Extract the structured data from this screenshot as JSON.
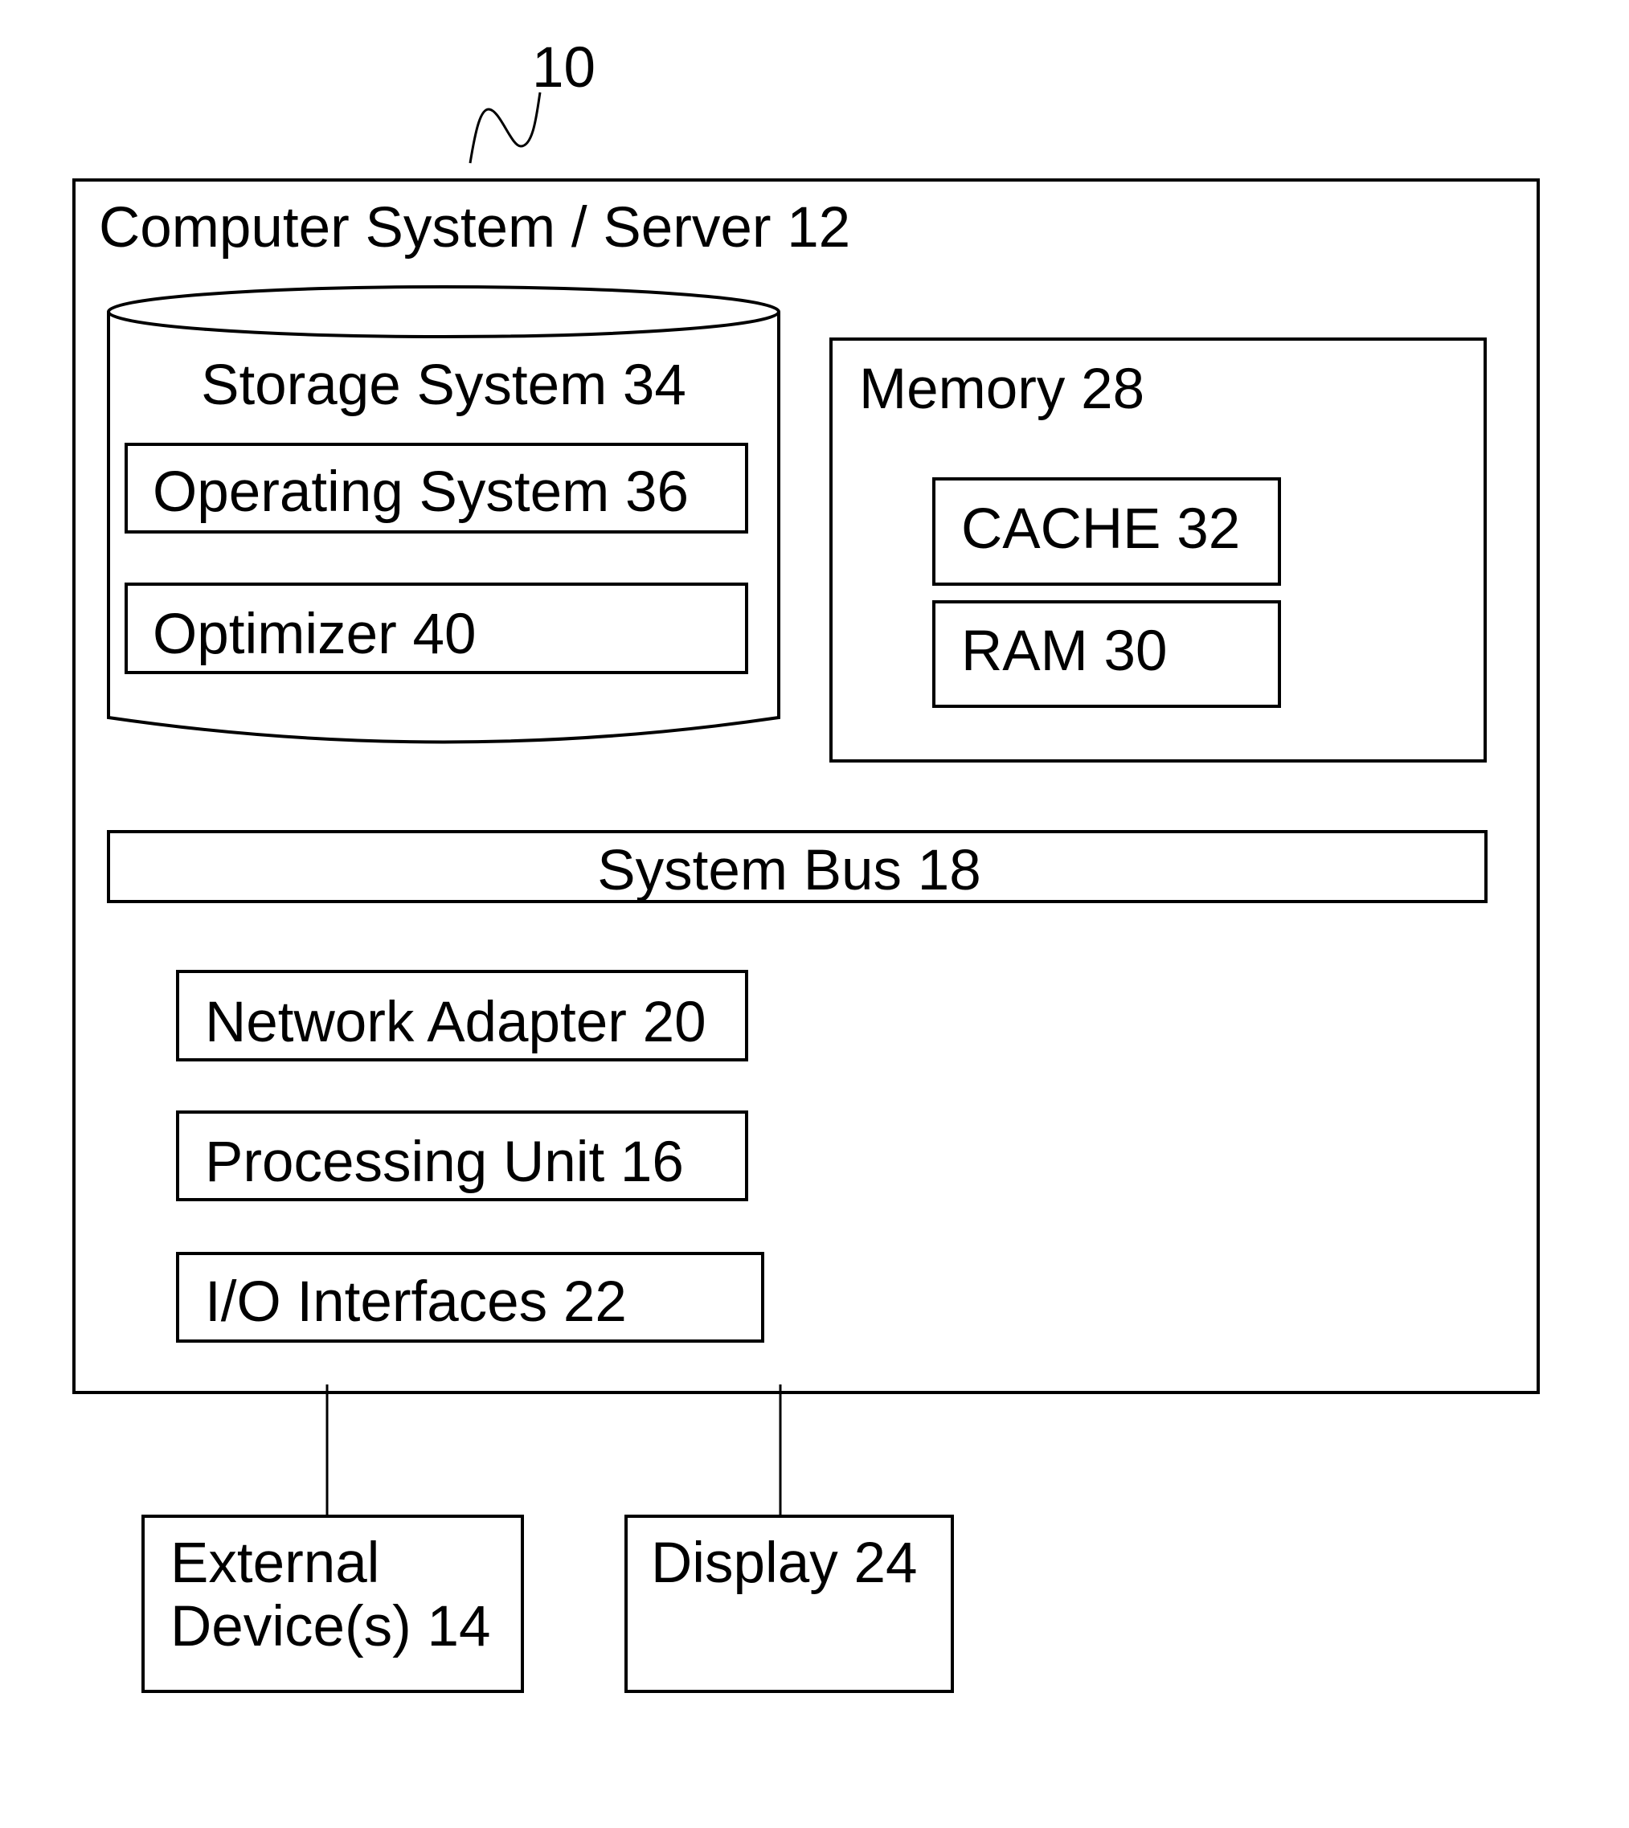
{
  "figure": {
    "reference_numeral": "10",
    "system": {
      "title": "Computer System / Server 12",
      "storage": {
        "label": "Storage System 34",
        "items": [
          "Operating System 36",
          "Optimizer 40"
        ]
      },
      "memory": {
        "label": "Memory 28",
        "items": [
          "CACHE 32",
          "RAM 30"
        ]
      },
      "bus": {
        "label": "System Bus 18"
      },
      "components": [
        "Network Adapter 20",
        "Processing Unit 16",
        "I/O Interfaces 22"
      ]
    },
    "external": {
      "devices": {
        "line1": "External",
        "line2": "Device(s) 14"
      },
      "display": {
        "label": "Display 24"
      }
    }
  },
  "colors": {
    "stroke": "#000000",
    "background": "#ffffff"
  }
}
